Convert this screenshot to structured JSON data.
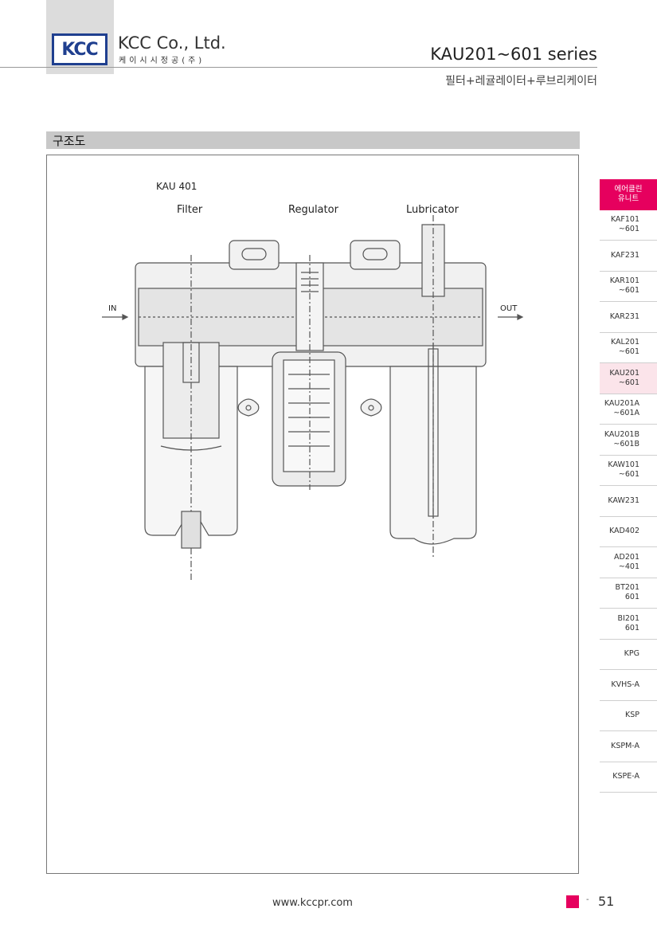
{
  "header": {
    "logo_text": "KCC",
    "company": "KCC Co., Ltd.",
    "company_kr": "케이시시정공(주)",
    "series": "KAU201~601 series",
    "series_sub": "필터+레귤레이터+루브리케이터"
  },
  "section": {
    "title": "구조도"
  },
  "diagram": {
    "model": "KAU 401",
    "labels": {
      "filter": "Filter",
      "regulator": "Regulator",
      "lubricator": "Lubricator"
    },
    "in_label": "IN",
    "out_label": "OUT"
  },
  "sidebar": {
    "items": [
      {
        "label": "에어클린\n유니트"
      },
      {
        "label": "KAF101\n~601"
      },
      {
        "label": "KAF231"
      },
      {
        "label": "KAR101\n~601"
      },
      {
        "label": "KAR231"
      },
      {
        "label": "KAL201\n~601"
      },
      {
        "label": "KAU201\n~601"
      },
      {
        "label": "KAU201A\n~601A"
      },
      {
        "label": "KAU201B\n~601B"
      },
      {
        "label": "KAW101\n~601"
      },
      {
        "label": "KAW231"
      },
      {
        "label": "KAD402"
      },
      {
        "label": "AD201\n~401"
      },
      {
        "label": "BT201\n601"
      },
      {
        "label": "BI201\n601"
      },
      {
        "label": "KPG"
      },
      {
        "label": "KVHS-A"
      },
      {
        "label": "KSP"
      },
      {
        "label": "KSPM-A"
      },
      {
        "label": "KSPE-A"
      }
    ],
    "active_color": "#e6005e",
    "current_color": "#fbe4ea"
  },
  "footer": {
    "url": "www.kccpr.com",
    "dash": "-",
    "page": "51"
  }
}
